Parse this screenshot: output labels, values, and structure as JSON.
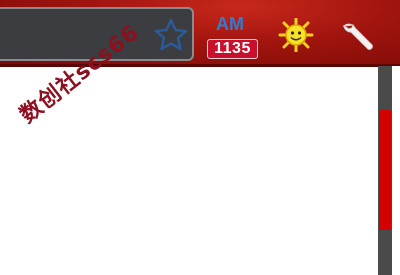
{
  "toolbar": {
    "accent_color": "#a0140e",
    "omnibox_bg": "#3c3d40"
  },
  "bookmark_star": {
    "icon": "star-outline-icon"
  },
  "am_extension": {
    "label": "AM",
    "count": "1135",
    "label_color": "#2a7fd4",
    "badge_color": "#c8102e"
  },
  "sun_extension": {
    "icon": "sun-icon"
  },
  "menu": {
    "icon": "wrench-icon"
  },
  "watermark": {
    "text": "数创社scs66"
  },
  "scrollbar": {
    "thumb_color": "#d40000",
    "track_color": "#4a4a4a"
  }
}
